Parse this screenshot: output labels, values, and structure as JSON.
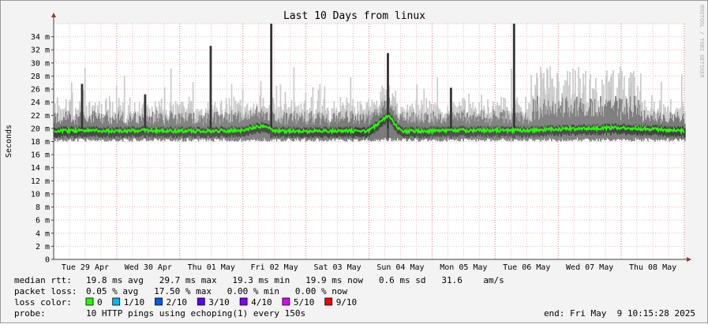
{
  "chart_data": {
    "type": "line",
    "title": "Last 10 Days from linux",
    "ylabel": "Seconds",
    "watermark": "RRDTOOL / TOBI OETIKER",
    "ylim": [
      0,
      0.036
    ],
    "y_ticks": [
      {
        "value": 0,
        "label": "0"
      },
      {
        "value": 0.002,
        "label": "2 m"
      },
      {
        "value": 0.004,
        "label": "4 m"
      },
      {
        "value": 0.006,
        "label": "6 m"
      },
      {
        "value": 0.008,
        "label": "8 m"
      },
      {
        "value": 0.01,
        "label": "10 m"
      },
      {
        "value": 0.012,
        "label": "12 m"
      },
      {
        "value": 0.014,
        "label": "14 m"
      },
      {
        "value": 0.016,
        "label": "16 m"
      },
      {
        "value": 0.018,
        "label": "18 m"
      },
      {
        "value": 0.02,
        "label": "20 m"
      },
      {
        "value": 0.022,
        "label": "22 m"
      },
      {
        "value": 0.024,
        "label": "24 m"
      },
      {
        "value": 0.026,
        "label": "26 m"
      },
      {
        "value": 0.028,
        "label": "28 m"
      },
      {
        "value": 0.03,
        "label": "30 m"
      },
      {
        "value": 0.032,
        "label": "32 m"
      },
      {
        "value": 0.034,
        "label": "34 m"
      }
    ],
    "x_ticks": [
      "Tue 29 Apr",
      "Wed 30 Apr",
      "Thu 01 May",
      "Fri 02 May",
      "Sat 03 May",
      "Sun 04 May",
      "Mon 05 May",
      "Tue 06 May",
      "Wed 07 May",
      "Thu 08 May"
    ],
    "median_series": {
      "name": "median rtt",
      "x_days": [
        0.0,
        0.5,
        1.0,
        1.5,
        2.0,
        2.5,
        3.0,
        3.35,
        3.5,
        4.0,
        4.5,
        5.0,
        5.3,
        5.5,
        6.0,
        6.5,
        7.0,
        7.5,
        8.0,
        8.5,
        9.0,
        9.5,
        10.0
      ],
      "values_ms": [
        19.6,
        19.7,
        19.6,
        19.7,
        19.6,
        19.6,
        19.7,
        20.5,
        19.6,
        19.6,
        19.6,
        19.6,
        22.0,
        19.6,
        19.6,
        19.7,
        19.7,
        19.7,
        19.9,
        20.0,
        20.1,
        19.9,
        19.6
      ]
    },
    "spikes": [
      {
        "day": 2.49,
        "max_ms": 32.6
      },
      {
        "day": 3.45,
        "max_ms": 36.0
      },
      {
        "day": 5.3,
        "max_ms": 31.5
      },
      {
        "day": 7.3,
        "max_ms": 36.0
      },
      {
        "day": 0.45,
        "max_ms": 26.8
      },
      {
        "day": 1.45,
        "max_ms": 25.2
      },
      {
        "day": 6.3,
        "max_ms": 26.2
      }
    ],
    "smoke_zones": [
      {
        "from_day": 7.6,
        "to_day": 9.3,
        "top_ms": 29.5
      }
    ],
    "legend": {
      "median_rtt_label": "median rtt:",
      "median_rtt_values": "19.8 ms avg   29.7 ms max   19.3 ms min   19.9 ms now   0.6 ms sd   31.6    am/s",
      "packet_loss_label": "packet loss:",
      "packet_loss_values": "0.05 % avg   17.50 % max   0.00 % min   0.00 % now",
      "loss_color_label": "loss color:",
      "loss_colors": [
        {
          "label": "0",
          "color": "#26ff00"
        },
        {
          "label": "1/10",
          "color": "#00b8ff"
        },
        {
          "label": "2/10",
          "color": "#0059ff"
        },
        {
          "label": "3/10",
          "color": "#5e00ff"
        },
        {
          "label": "4/10",
          "color": "#7e00ff"
        },
        {
          "label": "5/10",
          "color": "#dd00ff"
        },
        {
          "label": "9/10",
          "color": "#ff0000"
        }
      ],
      "probe_label": "probe:",
      "probe_text": "10 HTTP pings using echoping(1) every 150s",
      "end_text": "end: Fri May  9 10:15:28 2025"
    },
    "colors": {
      "background": "#f3f3f3",
      "plot_background": "#ffffff",
      "grid_minor": "#e8b9b9",
      "grid_major": "#e07a7a",
      "axis": "#a03030",
      "median_line": "#26ff00"
    }
  }
}
